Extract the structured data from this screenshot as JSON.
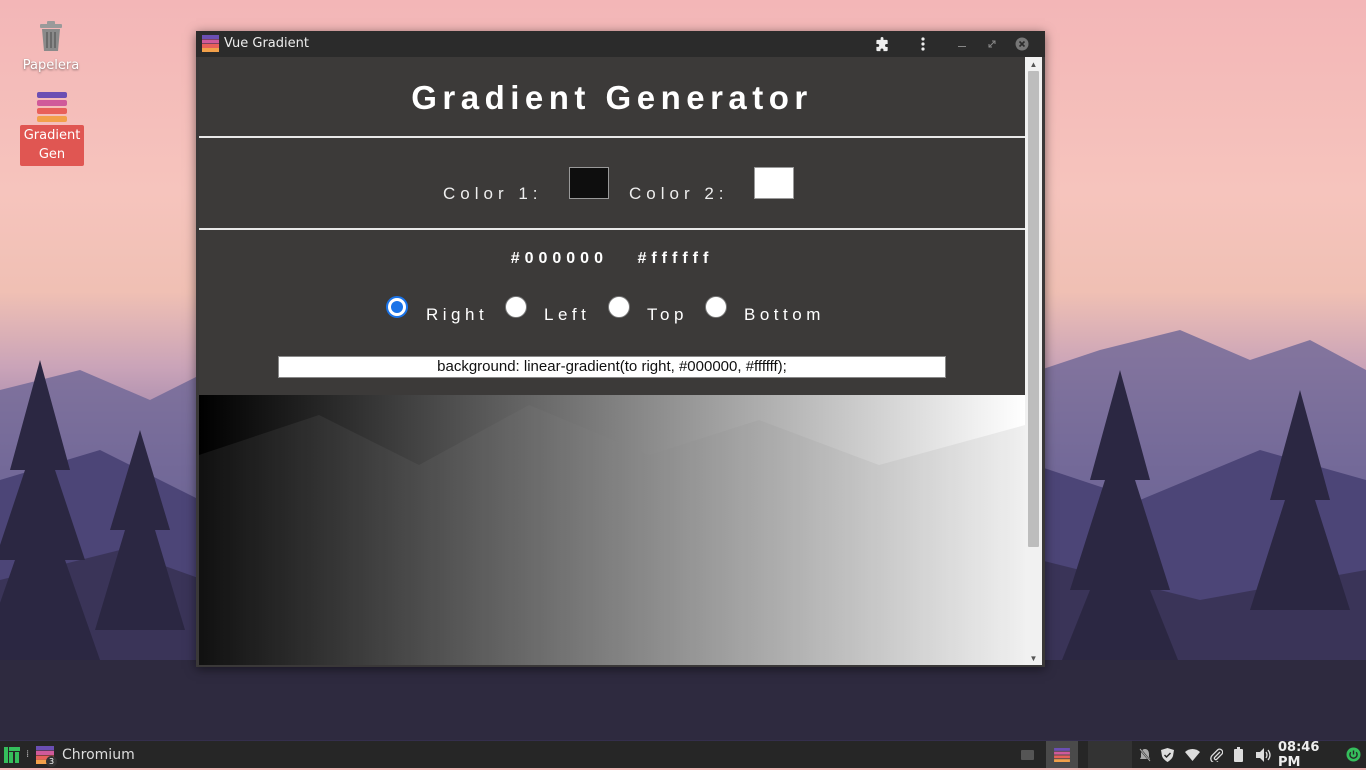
{
  "desktop": {
    "icons": [
      {
        "label": "Papelera"
      },
      {
        "label": "Gradient\nGen"
      }
    ]
  },
  "window": {
    "title": "Vue Gradient",
    "buttons": [
      "extensions",
      "menu",
      "minimize",
      "maximize",
      "close"
    ]
  },
  "app": {
    "heading": "Gradient Generator",
    "color1_label": "Color 1:",
    "color2_label": "Color 2:",
    "color1_value": "#000000",
    "color2_value": "#ffffff",
    "directions": [
      {
        "label": "Right",
        "selected": true
      },
      {
        "label": "Left",
        "selected": false
      },
      {
        "label": "Top",
        "selected": false
      },
      {
        "label": "Bottom",
        "selected": false
      }
    ],
    "css_output": "background: linear-gradient(to right, #000000, #ffffff);"
  },
  "taskbar": {
    "task_label": "Chromium",
    "task_count": "3",
    "clock": "08:46 PM"
  },
  "colors": {
    "radio_accent": "#1a73e8",
    "selected_icon_bg": "#e05652",
    "window_bg": "#3c3a39"
  }
}
